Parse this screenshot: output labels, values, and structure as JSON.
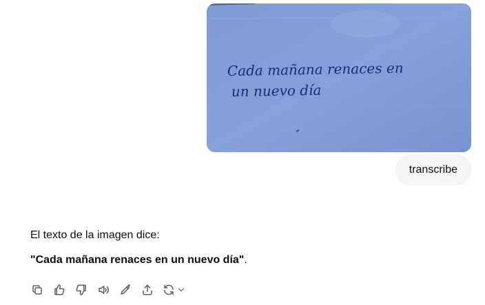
{
  "image": {
    "handwriting_line1": "Cada mañana renaces en",
    "handwriting_line2": "un nuevo día",
    "paper_color": "#7d9ad4",
    "ink_color": "#1a2a7a"
  },
  "user_message": {
    "text": "transcribe"
  },
  "assistant_message": {
    "intro": "El texto de la imagen dice:",
    "quote": "\"Cada mañana renaces en un nuevo día\"",
    "quote_suffix": "."
  },
  "actions": [
    {
      "icon": "copy-icon"
    },
    {
      "icon": "thumbs-up-icon"
    },
    {
      "icon": "thumbs-down-icon"
    },
    {
      "icon": "read-aloud-icon"
    },
    {
      "icon": "edit-icon"
    },
    {
      "icon": "share-icon"
    },
    {
      "icon": "regenerate-icon"
    }
  ]
}
